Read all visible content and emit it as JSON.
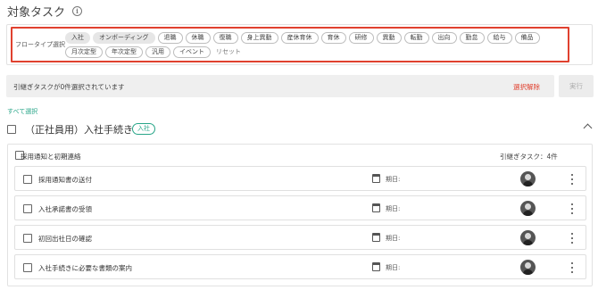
{
  "header": {
    "title": "対象タスク",
    "info_icon": "info-icon"
  },
  "filter": {
    "label": "フロータイプ選択",
    "chips": [
      {
        "label": "入社",
        "selected": true
      },
      {
        "label": "オンボーディング",
        "selected": true
      },
      {
        "label": "退職",
        "selected": false
      },
      {
        "label": "休職",
        "selected": false
      },
      {
        "label": "復職",
        "selected": false
      },
      {
        "label": "身上異動",
        "selected": false
      },
      {
        "label": "産休育休",
        "selected": false
      },
      {
        "label": "育休",
        "selected": false
      },
      {
        "label": "研修",
        "selected": false
      },
      {
        "label": "異動",
        "selected": false
      },
      {
        "label": "転勤",
        "selected": false
      },
      {
        "label": "出向",
        "selected": false
      },
      {
        "label": "勤怠",
        "selected": false
      },
      {
        "label": "給与",
        "selected": false
      },
      {
        "label": "備品",
        "selected": false
      },
      {
        "label": "月次定型",
        "selected": false
      },
      {
        "label": "年次定型",
        "selected": false
      },
      {
        "label": "汎用",
        "selected": false
      },
      {
        "label": "イベント",
        "selected": false
      }
    ],
    "reset_label": "リセット",
    "highlight_color": "#e0412f"
  },
  "status": {
    "text": "引継ぎタスクが0件選択されています",
    "deselect_label": "選択解除",
    "run_label": "実行"
  },
  "select_all_label": "すべて選択",
  "group": {
    "title": "（正社員用）入社手続き",
    "badge": "入社",
    "section": {
      "title": "採用通知と初期連絡",
      "count_label": "引継ぎタスク：4件",
      "tasks": [
        {
          "name": "採用通知書の送付",
          "due_label": "期日:"
        },
        {
          "name": "入社承諾書の受領",
          "due_label": "期日:"
        },
        {
          "name": "初回出社日の確認",
          "due_label": "期日:"
        },
        {
          "name": "入社手続きに必要な書類の案内",
          "due_label": "期日:"
        }
      ]
    }
  },
  "colors": {
    "accent": "#27a588",
    "danger": "#e0412f"
  }
}
